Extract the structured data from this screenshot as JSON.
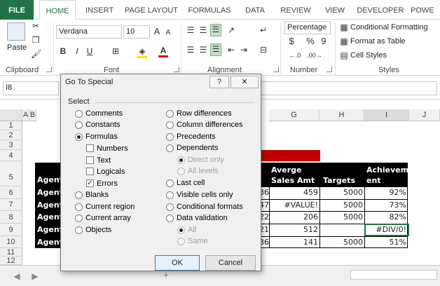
{
  "ribbon_tabs": [
    "FILE",
    "HOME",
    "INSERT",
    "PAGE LAYOUT",
    "FORMULAS",
    "DATA",
    "REVIEW",
    "VIEW",
    "DEVELOPER",
    "POWE"
  ],
  "clipboard": {
    "paste": "Paste",
    "group_label": "Clipboard"
  },
  "font": {
    "name": "Verdana",
    "size": "10",
    "group_label": "Font",
    "bold": "B",
    "italic": "I",
    "underline": "U",
    "grow": "A",
    "shrink": "A"
  },
  "alignment": {
    "group_label": "Alignment"
  },
  "number": {
    "format": "Percentage",
    "currency": "$",
    "percent": "%",
    "comma": "9",
    "group_label": "Number"
  },
  "styles": {
    "conditional": "Conditional Formatting",
    "format_table": "Format as Table",
    "cell_styles": "Cell Styles",
    "group_label": "Styles"
  },
  "formula_bar": {
    "name_box": "I8"
  },
  "columns": [
    "A",
    "B",
    "G",
    "H",
    "I",
    "J"
  ],
  "rows": [
    "1",
    "2",
    "3",
    "4",
    "5",
    "6",
    "7",
    "8",
    "9",
    "10",
    "11",
    "12"
  ],
  "table": {
    "header_agent": "Agent",
    "header_g_line1": "Averge",
    "header_g_line2": "Sales Amt",
    "header_h": "Targets",
    "header_i_line1": "Achievem",
    "header_i_line2": "ent",
    "rows": [
      {
        "a": "Agent",
        "f": "36",
        "g": "459",
        "h": "5000",
        "i": "92%"
      },
      {
        "a": "Agent",
        "f": "47",
        "g": "#VALUE!",
        "h": "5000",
        "i": "73%"
      },
      {
        "a": "Agent",
        "f": "22",
        "g": "206",
        "h": "5000",
        "i": "82%"
      },
      {
        "a": "Agent",
        "f": "21",
        "g": "512",
        "h": "",
        "i": "#DIV/0!"
      },
      {
        "a": "Agent",
        "f": "36",
        "g": "141",
        "h": "5000",
        "i": "51%"
      }
    ]
  },
  "dialog": {
    "title": "Go To Special",
    "help": "?",
    "close": "✕",
    "select_label": "Select",
    "left_options": [
      "Comments",
      "Constants",
      "Formulas",
      "Numbers",
      "Text",
      "Logicals",
      "Errors",
      "Blanks",
      "Current region",
      "Current array",
      "Objects"
    ],
    "right_options": [
      "Row differences",
      "Column differences",
      "Precedents",
      "Dependents",
      "Direct only",
      "All levels",
      "Last cell",
      "Visible cells only",
      "Conditional formats",
      "Data validation",
      "All",
      "Same"
    ],
    "ok": "OK",
    "cancel": "Cancel"
  },
  "status": {
    "prev": "◀",
    "next": "▶",
    "add": "+"
  }
}
